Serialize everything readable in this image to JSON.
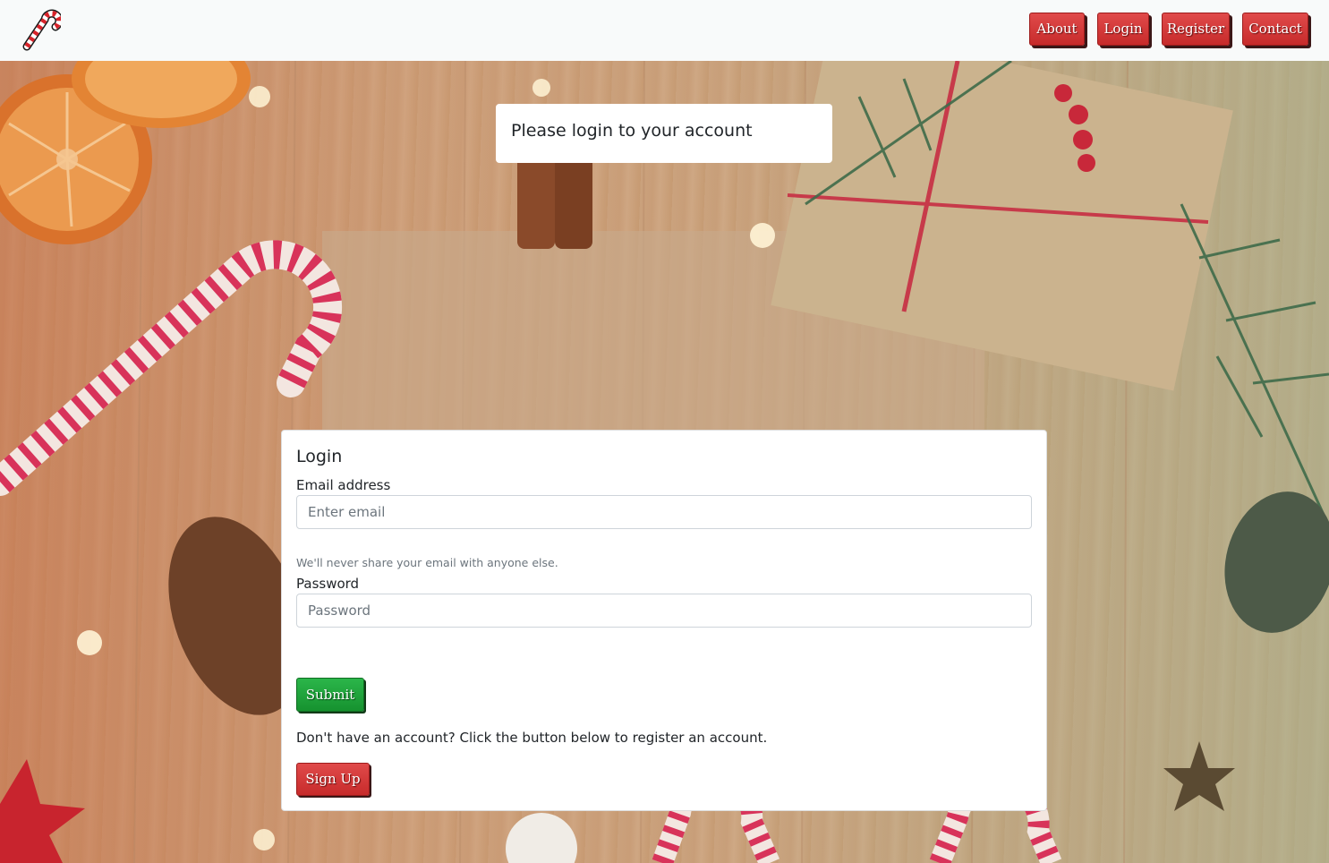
{
  "navbar": {
    "logo_icon": "candy-cane-icon",
    "items": [
      {
        "label": "About"
      },
      {
        "label": "Login"
      },
      {
        "label": "Register"
      },
      {
        "label": "Contact"
      }
    ]
  },
  "banner": {
    "heading": "Please login to your account"
  },
  "login_form": {
    "title": "Login",
    "email": {
      "label": "Email address",
      "placeholder": "Enter email",
      "value": "",
      "help": "We'll never share your email with anyone else."
    },
    "password": {
      "label": "Password",
      "placeholder": "Password",
      "value": ""
    },
    "submit_label": "Submit",
    "register_prompt": "Don't have an account? Click the button below to register an account.",
    "signup_label": "Sign Up"
  },
  "colors": {
    "accent_red": "#d23a3a",
    "accent_green": "#1fa53c",
    "navbar_bg": "#f8fafa"
  }
}
